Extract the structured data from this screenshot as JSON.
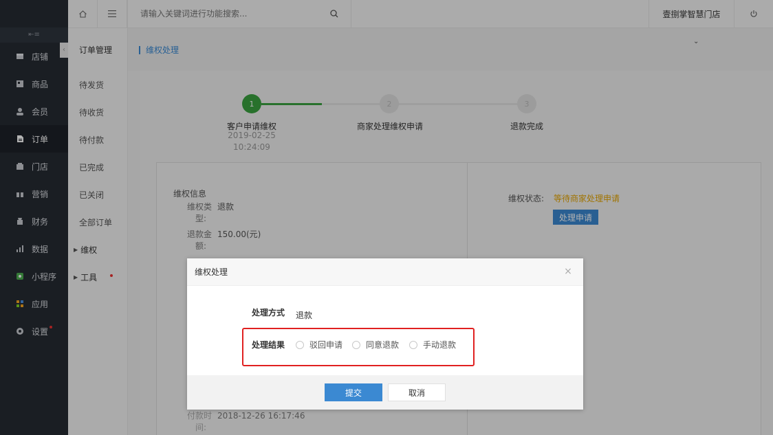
{
  "colors": {
    "accent": "#3b89d2",
    "success": "#3aa240",
    "warning": "#e5a500",
    "danger": "#e02020"
  },
  "search": {
    "placeholder": "请输入关键词进行功能搜索..."
  },
  "header": {
    "store_name": "壹捌掌智慧门店"
  },
  "sidebar": {
    "items": [
      {
        "label": "店铺",
        "icon": "shop-icon"
      },
      {
        "label": "商品",
        "icon": "goods-icon"
      },
      {
        "label": "会员",
        "icon": "user-icon"
      },
      {
        "label": "订单",
        "icon": "order-icon"
      },
      {
        "label": "门店",
        "icon": "store-icon"
      },
      {
        "label": "营销",
        "icon": "gift-icon"
      },
      {
        "label": "财务",
        "icon": "money-icon"
      },
      {
        "label": "数据",
        "icon": "chart-icon"
      },
      {
        "label": "小程序",
        "icon": "miniapp-icon"
      },
      {
        "label": "应用",
        "icon": "apps-icon"
      },
      {
        "label": "设置",
        "icon": "gear-icon"
      }
    ]
  },
  "subnav": {
    "title": "订单管理",
    "items": [
      "待发货",
      "待收货",
      "待付款",
      "已完成",
      "已关闭",
      "全部订单"
    ],
    "groups": [
      "维权",
      "工具"
    ]
  },
  "breadcrumb": "维权处理",
  "steps": [
    {
      "num": "1",
      "label": "客户申请维权",
      "date": "2019-02-25",
      "time": "10:24:09"
    },
    {
      "num": "2",
      "label": "商家处理维权申请"
    },
    {
      "num": "3",
      "label": "退款完成"
    }
  ],
  "info": {
    "title": "维权信息",
    "type_label_1": "维权类",
    "type_label_2": "型:",
    "type_value": "退款",
    "amount_label_1": "退款金",
    "amount_label_2": "额:",
    "amount_value": "150.00(元)",
    "paytime_label_1": "付款时",
    "paytime_label_2": "间:",
    "paytime_value": "2018-12-26 16:17:46"
  },
  "status": {
    "label": "维权状态:",
    "value": "等待商家处理申请",
    "button": "处理申请"
  },
  "modal": {
    "title": "维权处理",
    "method_label": "处理方式",
    "method_value": "退款",
    "result_label": "处理结果",
    "options": [
      "驳回申请",
      "同意退款",
      "手动退款"
    ],
    "submit": "提交",
    "cancel": "取消"
  }
}
